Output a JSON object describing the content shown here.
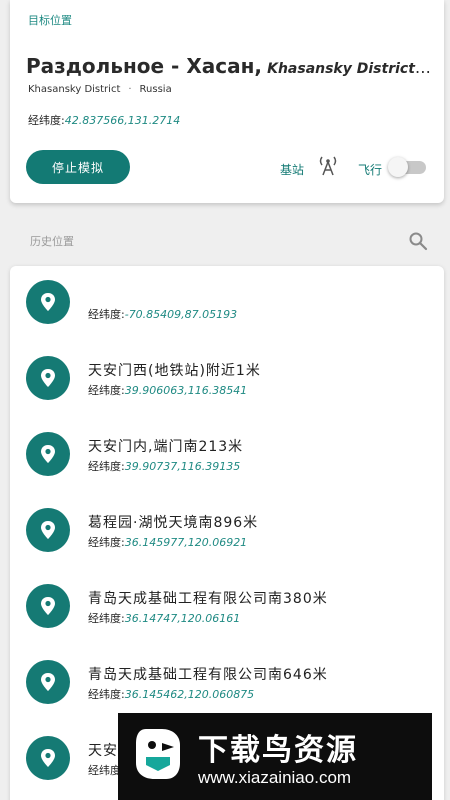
{
  "target": {
    "section_label": "目标位置",
    "title_name": "Раздольное - Хасан,",
    "title_sub": "Khasansky District, Prim…",
    "district": "Khasansky District",
    "country": "Russia",
    "coord_label": "经纬度:",
    "coord_value": "42.837566,131.2714",
    "stop_button": "停止模拟",
    "base_station_label": "基站",
    "flight_label": "飞行",
    "flight_enabled": false
  },
  "history": {
    "section_label": "历史位置",
    "coord_label": "经纬度:",
    "items": [
      {
        "name": "",
        "coord": "-70.85409,87.05193"
      },
      {
        "name": "天安门西(地铁站)附近1米",
        "coord": "39.906063,116.38541"
      },
      {
        "name": "天安门内,端门南213米",
        "coord": "39.90737,116.39135"
      },
      {
        "name": "葛程园·湖悦天境南896米",
        "coord": "36.145977,120.06921"
      },
      {
        "name": "青岛天成基础工程有限公司南380米",
        "coord": "36.14747,120.06161"
      },
      {
        "name": "青岛天成基础工程有限公司南646米",
        "coord": "36.145462,120.060875"
      },
      {
        "name": "天安",
        "coord": ""
      }
    ]
  },
  "watermark": {
    "title": "下载鸟资源",
    "url": "www.xiazainiao.com"
  },
  "colors": {
    "accent": "#137a74",
    "accent_text": "#1f8a83",
    "background": "#efefef"
  }
}
